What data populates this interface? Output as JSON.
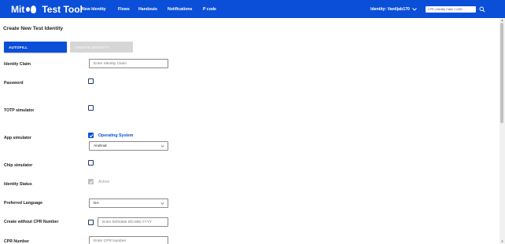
{
  "header": {
    "brand": {
      "left": "Mit",
      "right": "Test Tool"
    },
    "nav": [
      "New Identity",
      "Flows",
      "Handouts",
      "Notifications",
      "P code"
    ],
    "identity_label": "Identity: Vaniljab170",
    "search_placeholder": "CPR | Identity Claim | UUID",
    "brand_color": "#0b4fd8"
  },
  "page": {
    "title": "Create New Test Identity",
    "autofill_label": "AUTOFILL",
    "create_label": "CREATE IDENTITY"
  },
  "form": {
    "identity_claim": {
      "label": "Identity Claim",
      "placeholder": "Enter Identity Claim",
      "value": ""
    },
    "password": {
      "label": "Password",
      "checked": false
    },
    "totp": {
      "label": "TOTP simulator",
      "checked": false
    },
    "app": {
      "label": "App simulator",
      "checked": true,
      "option_label": "Operating System",
      "os_value": "Android"
    },
    "chip": {
      "label": "Chip simulator",
      "checked": false
    },
    "status": {
      "label": "Identity Status",
      "checked": true,
      "disabled": true,
      "option_label": "Active"
    },
    "language": {
      "label": "Preferred Language",
      "value": "DA"
    },
    "no_cpr": {
      "label": "Create without CPR Number",
      "checked": false,
      "placeholder": "Enter birthdate DD.MM.YYYY"
    },
    "cpr": {
      "label": "CPR Number",
      "placeholder": "Enter CPR Number"
    }
  }
}
